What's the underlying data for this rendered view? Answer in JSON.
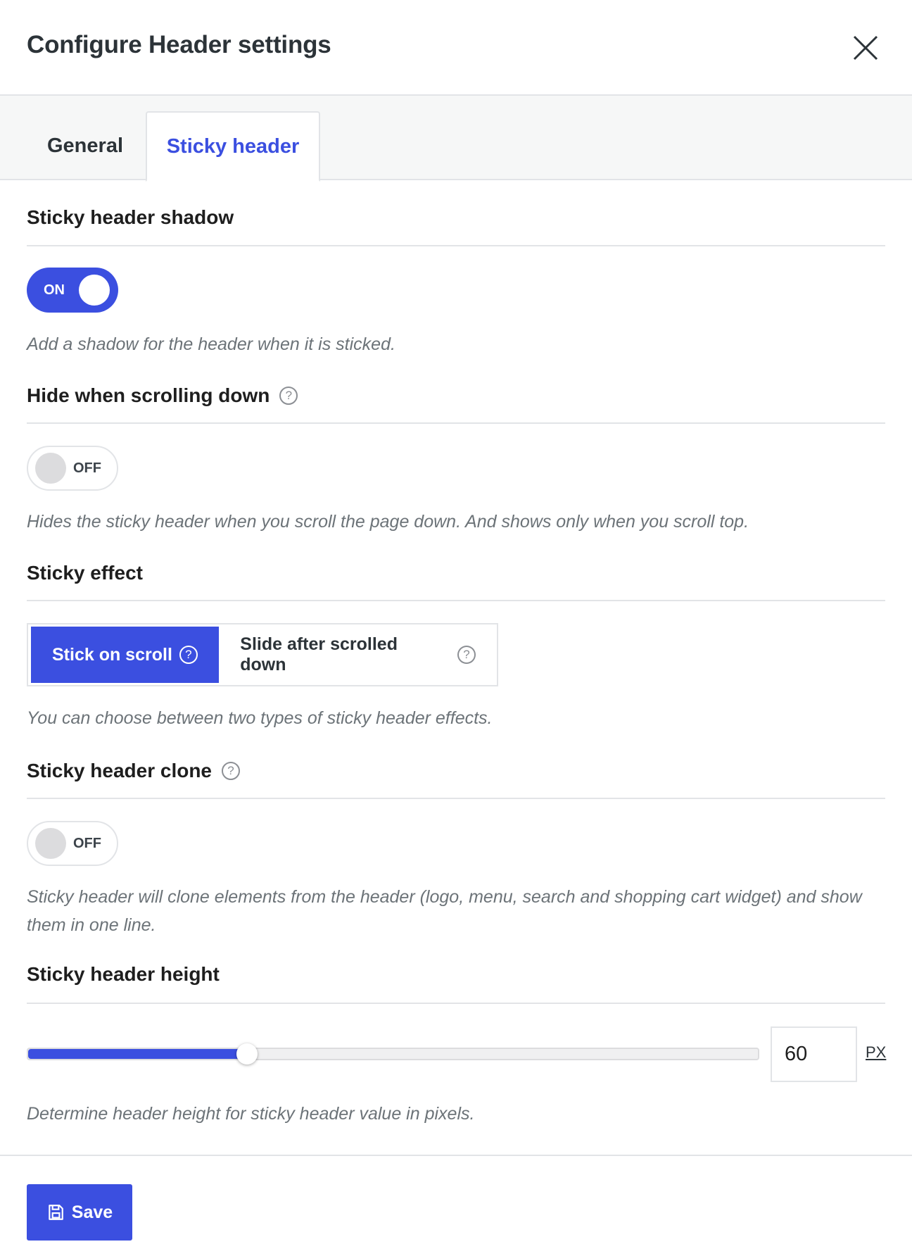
{
  "dialog": {
    "title": "Configure Header settings"
  },
  "tabs": [
    {
      "label": "General",
      "active": false
    },
    {
      "label": "Sticky header",
      "active": true
    }
  ],
  "sections": {
    "shadow": {
      "title": "Sticky header shadow",
      "toggle_label": "ON",
      "toggle_state": true,
      "description": "Add a shadow for the header when it is sticked."
    },
    "hide_scrolling": {
      "title": "Hide when scrolling down",
      "help": "?",
      "toggle_label": "OFF",
      "toggle_state": false,
      "description": "Hides the sticky header when you scroll the page down. And shows only when you scroll top."
    },
    "effect": {
      "title": "Sticky effect",
      "options": [
        {
          "label": "Stick on scroll",
          "help": "?",
          "selected": true
        },
        {
          "label": "Slide after scrolled down",
          "help": "?",
          "selected": false
        }
      ],
      "description": "You can choose between two types of sticky header effects."
    },
    "clone": {
      "title": "Sticky header clone",
      "help": "?",
      "toggle_label": "OFF",
      "toggle_state": false,
      "description": "Sticky header will clone elements from the header (logo, menu, search and shopping cart widget) and show them in one line."
    },
    "height": {
      "title": "Sticky header height",
      "value": "60",
      "unit": "PX",
      "slider_fraction": 0.3,
      "description": "Determine header height for sticky header value in pixels."
    }
  },
  "footer": {
    "save_label": "Save"
  },
  "colors": {
    "accent": "#3b4fe0",
    "border": "#e2e4e7",
    "muted_text": "#6c7378"
  },
  "icons": {
    "close": "close-icon",
    "help": "help-icon",
    "save": "save-icon"
  }
}
